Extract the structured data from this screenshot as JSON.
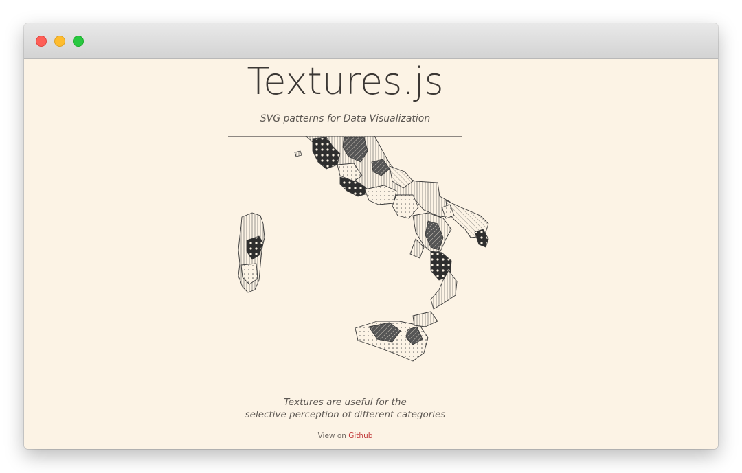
{
  "window": {
    "controls": [
      "close",
      "minimize",
      "zoom"
    ]
  },
  "header": {
    "title": "Textures.js",
    "subtitle": "SVG patterns for Data Visualization"
  },
  "caption": {
    "line1": "Textures are useful for the",
    "line2": "selective perception of different categories"
  },
  "footer": {
    "prefix": "View on ",
    "link_label": "Github"
  },
  "colors": {
    "background": "#fcf3e5",
    "text": "#3c3835",
    "link": "#c1393a"
  },
  "map": {
    "textures": [
      "dots-dark",
      "stripes-dark",
      "vertical-lines",
      "diagonal-lines",
      "sparse-dots"
    ]
  }
}
